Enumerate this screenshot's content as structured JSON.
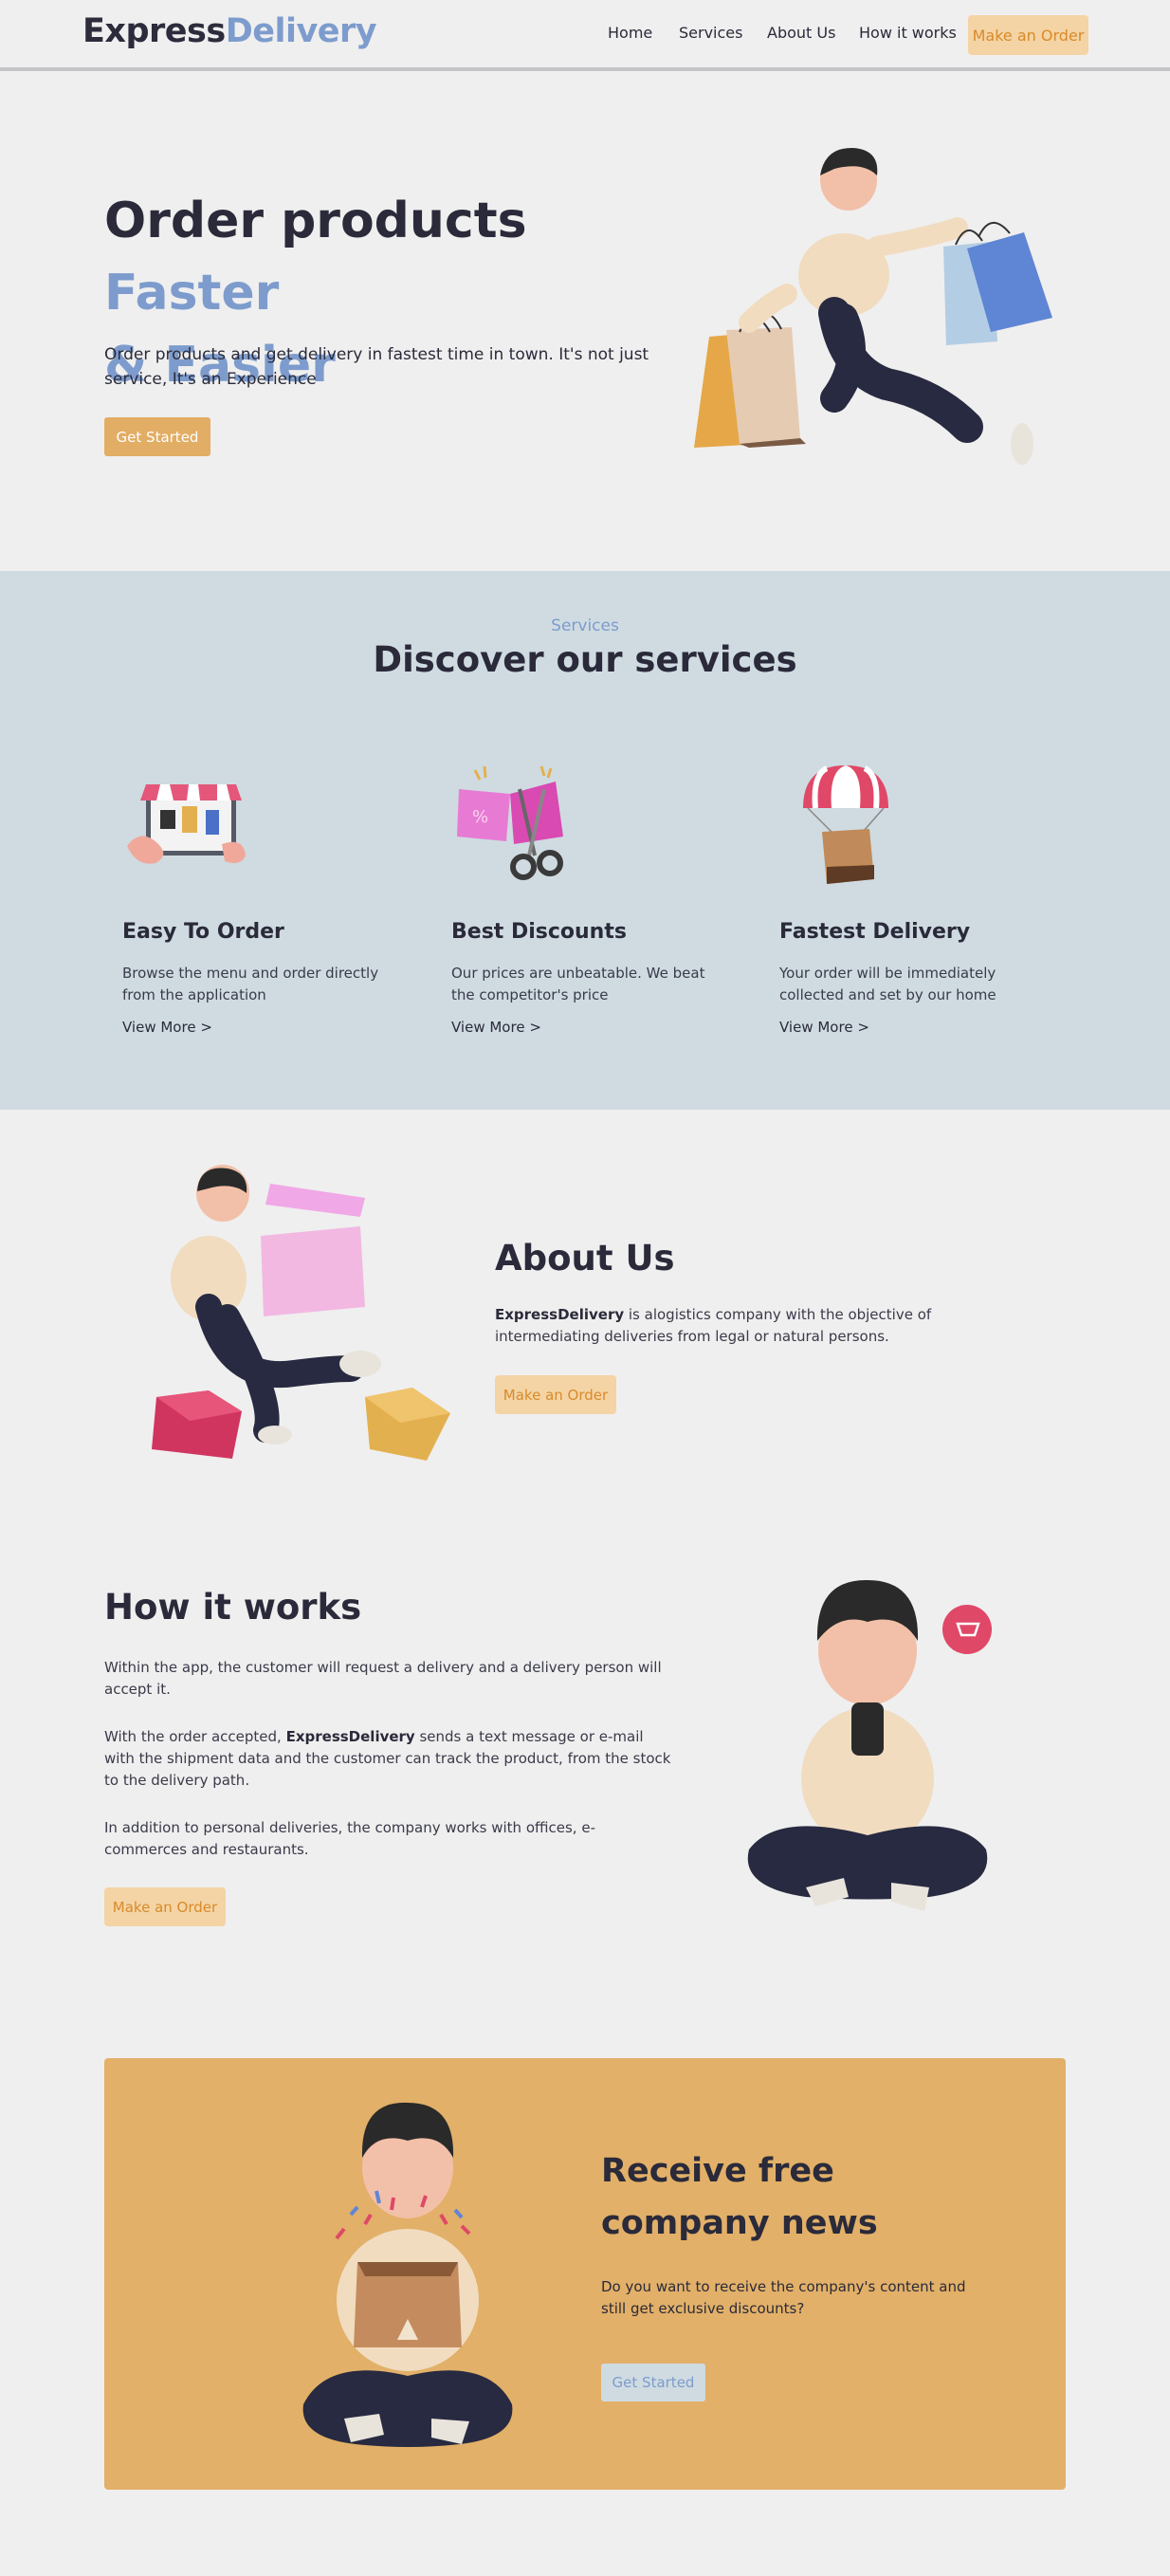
{
  "header": {
    "logo_part1": "Express",
    "logo_part2": "Delivery",
    "nav": [
      "Home",
      "Services",
      "About Us",
      "How it works"
    ],
    "cta": "Make an Order"
  },
  "hero": {
    "title_plain": "Order products ",
    "title_accent_1": "Faster",
    "title_accent_2": "& Easier",
    "subtitle": "Order products and get delivery in fastest time in town. It's not just service, It's an Experience",
    "button": "Get Started"
  },
  "services": {
    "kicker": "Services",
    "title": "Discover our services",
    "cards": [
      {
        "title": "Easy To Order",
        "text": "Browse the menu and order directly from the application",
        "link": "View More >",
        "icon": "shop-tablet-icon"
      },
      {
        "title": "Best Discounts",
        "text": "Our prices are unbeatable. We beat the competitor's price",
        "link": "View More >",
        "icon": "discount-coupon-icon"
      },
      {
        "title": "Fastest Delivery",
        "text": "Your order will be immediately collected and set by our home",
        "link": "View More >",
        "icon": "parachute-box-icon"
      }
    ]
  },
  "about": {
    "title": "About Us",
    "brand": "ExpressDelivery",
    "text": " is alogistics company with the objective of intermediating deliveries from legal or natural persons.",
    "button": "Make an Order"
  },
  "how": {
    "title": "How it works",
    "p1": "Within the app, the customer will request a delivery and a delivery person will accept it.",
    "p2_before": "With the order accepted, ",
    "p2_brand": "ExpressDelivery",
    "p2_after": " sends a text message or e-mail with the shipment data and the customer can track the product, from the stock to the delivery path.",
    "p3": "In addition to personal deliveries, the company works with offices, e-commerces and restaurants.",
    "button": "Make an Order"
  },
  "newsletter": {
    "title": "Receive free company news",
    "text": "Do you want to receive the company's content and still get exclusive discounts?",
    "button": "Get Started"
  },
  "colors": {
    "background": "#efefef",
    "accent_blue": "#7d9ccd",
    "gold": "#e2ad64",
    "peach": "#f4d4a4",
    "services_bg": "#cfdbe1",
    "dark_text": "#2a2a3a"
  }
}
